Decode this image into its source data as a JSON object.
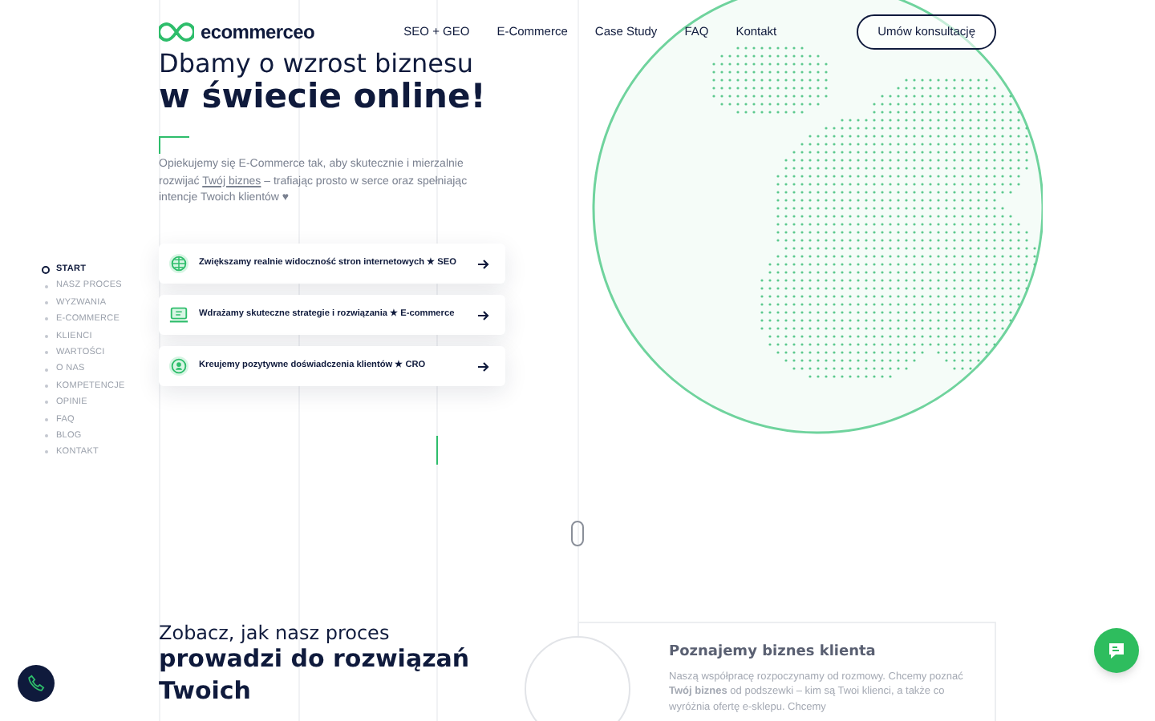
{
  "header": {
    "logo": "ecommerceo",
    "nav": [
      {
        "label": "SEO + GEO"
      },
      {
        "label": "E-Commerce"
      },
      {
        "label": "Case Study"
      },
      {
        "label": "FAQ"
      },
      {
        "label": "Kontakt"
      }
    ],
    "cta": "Umów konsultację"
  },
  "hero": {
    "title_line1": "Dbamy o wzrost biznesu",
    "title_line2": "w świecie online!",
    "intro_start": "Opiekujemy się E-Commerce tak, aby skutecznie i mierzalnie rozwijać",
    "intro_link": "Twój biznes",
    "intro_end": "– trafiając prosto w serce oraz spełniając intencje Twoich klientów ♥"
  },
  "side_nav": [
    {
      "label": "START",
      "selected": true
    },
    {
      "label": "NASZ PROCES",
      "selected": false
    },
    {
      "label": "WYZWANIA",
      "selected": false
    },
    {
      "label": "E-COMMERCE",
      "selected": false
    },
    {
      "label": "KLIENCI",
      "selected": false
    },
    {
      "label": "WARTOŚCI",
      "selected": false
    },
    {
      "label": "O NAS",
      "selected": false
    },
    {
      "label": "KOMPETENCJE",
      "selected": false
    },
    {
      "label": "OPINIE",
      "selected": false
    },
    {
      "label": "FAQ",
      "selected": false
    },
    {
      "label": "BLOG",
      "selected": false
    },
    {
      "label": "KONTAKT",
      "selected": false
    }
  ],
  "services": [
    {
      "kind": "globe",
      "text": "Zwiększamy realnie widoczność stron internetowych ★ SEO"
    },
    {
      "kind": "laptop",
      "text": "Wdrażamy skuteczne strategie i rozwiązania ★ E-commerce"
    },
    {
      "kind": "person",
      "text": "Kreujemy pozytywne doświadczenia klientów ★ CRO"
    }
  ],
  "process": {
    "lead": "Zobacz, jak nasz proces",
    "title": "prowadzi do rozwiązań Twoich",
    "step_title": "Poznajemy biznes klienta",
    "step_text": "Naszą współpracę rozpoczynamy od rozmowy. Chcemy poznać **Twój biznes** od podszewki – kim są Twoi klienci, a także co wyróżnia ofertę e-sklepu. Chcemy"
  }
}
